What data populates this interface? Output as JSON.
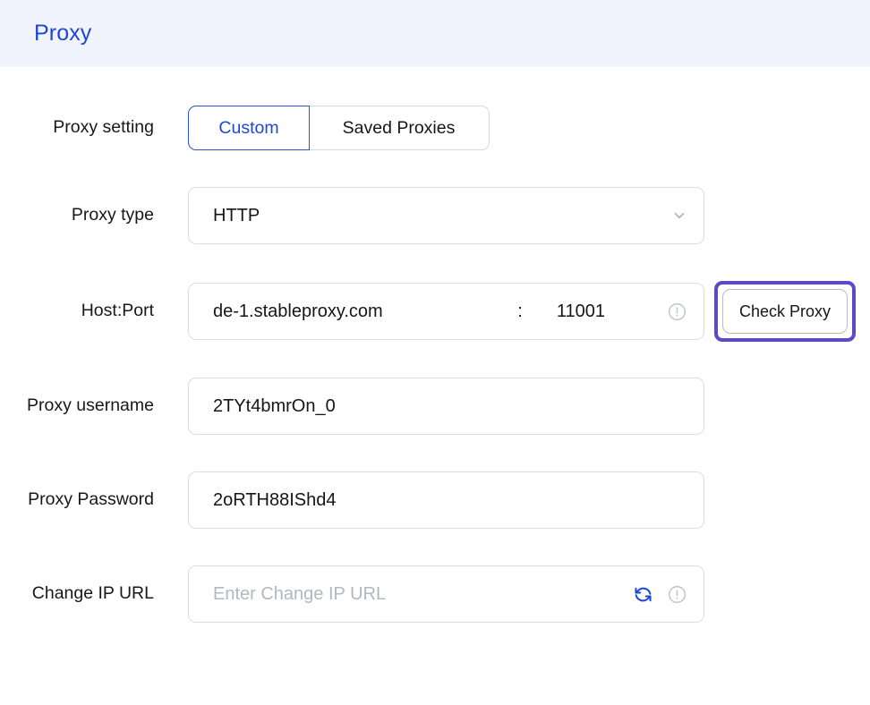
{
  "header": {
    "title": "Proxy",
    "background": "#f2f4fd",
    "title_color": "#1f46d8"
  },
  "form": {
    "rows": {
      "proxy_setting": {
        "label": "Proxy setting",
        "options": [
          {
            "label": "Custom",
            "selected": true
          },
          {
            "label": "Saved Proxies",
            "selected": false
          }
        ]
      },
      "proxy_type": {
        "label": "Proxy type",
        "value": "HTTP",
        "chevron_icon": "chevron-down-icon"
      },
      "host_port": {
        "label": "Host:Port",
        "host": "de-1.stableproxy.com",
        "separator": ":",
        "port": "11001",
        "info_icon": "exclamation-circle-icon",
        "action_button": "Check Proxy"
      },
      "proxy_username": {
        "label": "Proxy username",
        "value": "2TYt4bmrOn_0"
      },
      "proxy_password": {
        "label": "Proxy Password",
        "value": "2oRTH88IShd4"
      },
      "change_ip_url": {
        "label": "Change IP URL",
        "value": "",
        "placeholder": "Enter Change IP URL",
        "refresh_icon": "refresh-icon",
        "info_icon": "exclamation-circle-icon"
      }
    }
  },
  "colors": {
    "accent_blue": "#1f46d8",
    "focus_purple": "#5b4bc4",
    "refresh_blue": "#1f46d8",
    "icon_gray": "#b9bcc4",
    "border_gray": "#dcdee4",
    "text_dark": "#14161b",
    "placeholder_gray": "#b4b7bf"
  }
}
